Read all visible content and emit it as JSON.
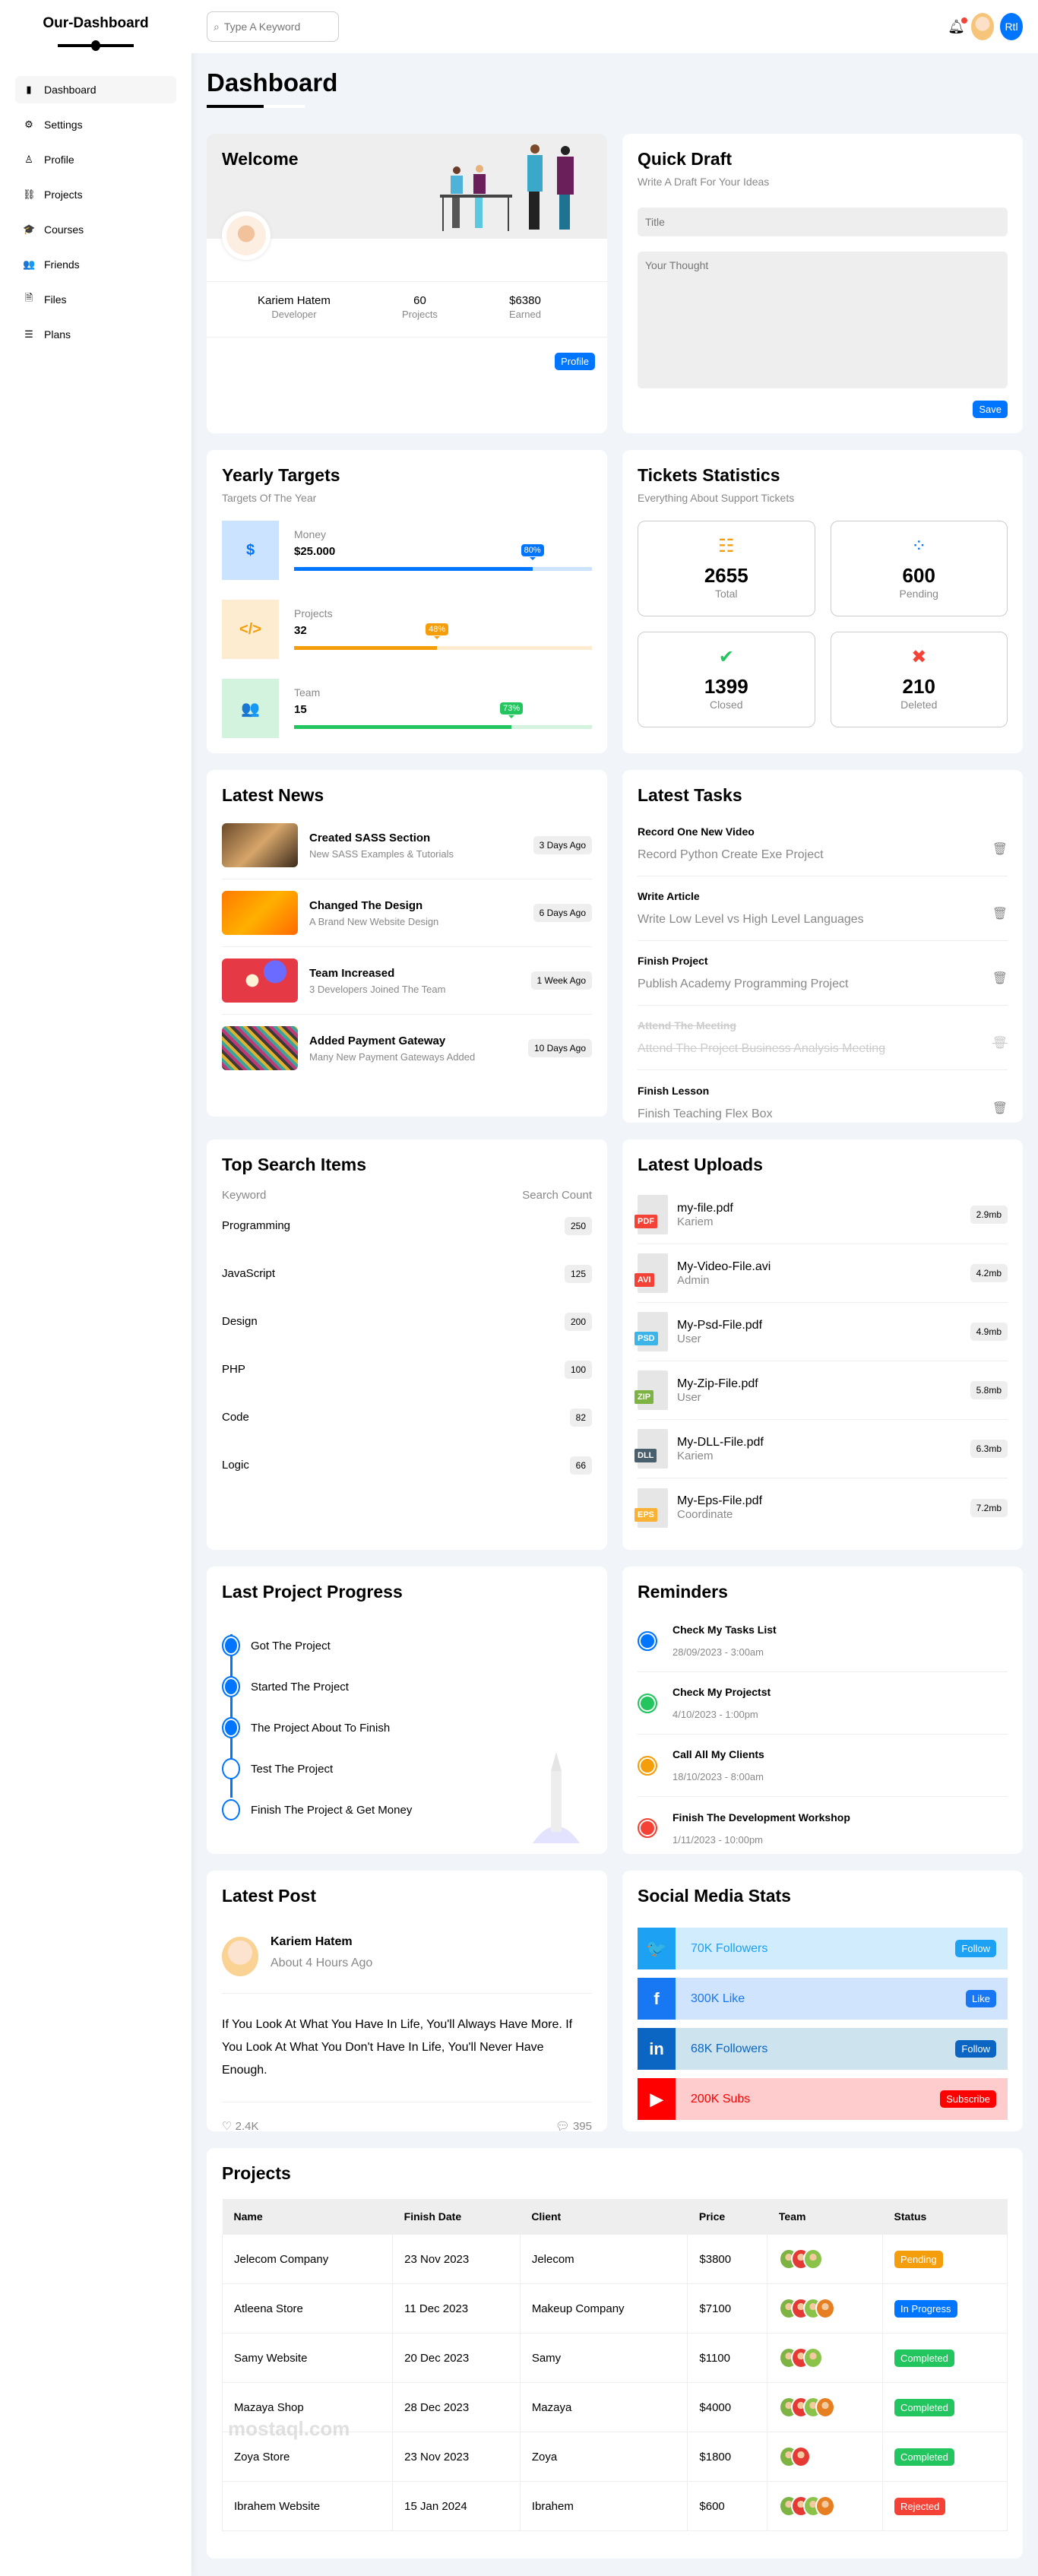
{
  "sidebar": {
    "logo": "Our-Dashboard",
    "items": [
      {
        "label": "Dashboard",
        "icon": "chart-bar-icon",
        "glyph": "▮"
      },
      {
        "label": "Settings",
        "icon": "gear-icon",
        "glyph": "⚙"
      },
      {
        "label": "Profile",
        "icon": "user-icon",
        "glyph": "♙"
      },
      {
        "label": "Projects",
        "icon": "diagram-icon",
        "glyph": "⛓"
      },
      {
        "label": "Courses",
        "icon": "graduation-cap-icon",
        "glyph": "🎓"
      },
      {
        "label": "Friends",
        "icon": "users-icon",
        "glyph": "👥"
      },
      {
        "label": "Files",
        "icon": "file-icon",
        "glyph": "🗎"
      },
      {
        "label": "Plans",
        "icon": "list-icon",
        "glyph": "☰"
      }
    ]
  },
  "header": {
    "search_placeholder": "Type A Keyword",
    "rtl_label": "Rtl"
  },
  "page_title": "Dashboard",
  "welcome": {
    "title": "Welcome",
    "name": "Kariem Hatem",
    "role": "Developer",
    "projects_value": "60",
    "projects_label": "Projects",
    "earned_value": "$6380",
    "earned_label": "Earned",
    "button": "Profile"
  },
  "draft": {
    "title": "Quick Draft",
    "subtitle": "Write A Draft For Your Ideas",
    "title_placeholder": "Title",
    "body_placeholder": "Your Thought",
    "button": "Save"
  },
  "targets": {
    "title": "Yearly Targets",
    "subtitle": "Targets Of The Year",
    "items": [
      {
        "label": "Money",
        "value": "$25.000",
        "percent": 80,
        "percent_label": "80%",
        "icon": "dollar-icon",
        "glyph": "$",
        "color": "#0075ff",
        "bg": "#cce3ff"
      },
      {
        "label": "Projects",
        "value": "32",
        "percent": 48,
        "percent_label": "48%",
        "icon": "code-icon",
        "glyph": "</>",
        "color": "#f59e0b",
        "bg": "#fdecd0"
      },
      {
        "label": "Team",
        "value": "15",
        "percent": 73,
        "percent_label": "73%",
        "icon": "users-icon",
        "glyph": "👥",
        "color": "#22c55e",
        "bg": "#d3f3df"
      }
    ]
  },
  "tickets": {
    "title": "Tickets Statistics",
    "subtitle": "Everything About Support Tickets",
    "items": [
      {
        "value": "2655",
        "label": "Total",
        "icon": "list-icon",
        "glyph": "☷",
        "color": "#f59e0b"
      },
      {
        "value": "600",
        "label": "Pending",
        "icon": "spinner-icon",
        "glyph": "⁘",
        "color": "#0075ff"
      },
      {
        "value": "1399",
        "label": "Closed",
        "icon": "check-circle-icon",
        "glyph": "✔",
        "color": "#22c55e"
      },
      {
        "value": "210",
        "label": "Deleted",
        "icon": "close-square-icon",
        "glyph": "✖",
        "color": "#f44336"
      }
    ]
  },
  "news": {
    "title": "Latest News",
    "items": [
      {
        "title": "Created SASS Section",
        "desc": "New SASS Examples & Tutorials",
        "time": "3 Days Ago",
        "bg": "linear-gradient(135deg,#6b4a2a,#d6a56a,#3a2a1a)"
      },
      {
        "title": "Changed The Design",
        "desc": "A Brand New Website Design",
        "time": "6 Days Ago",
        "bg": "linear-gradient(135deg,#ff7a00,#ffb000,#ff6a00)"
      },
      {
        "title": "Team Increased",
        "desc": "3 Developers Joined The Team",
        "time": "1 Week Ago",
        "bg": "radial-gradient(circle at 70% 30%,#6b6bff 0 18%,transparent 19%),radial-gradient(circle at 40% 50%,#fff3d6 0 12%,transparent 13%),#e63946"
      },
      {
        "title": "Added Payment Gateway",
        "desc": "Many New Payment Gateways Added",
        "time": "10 Days Ago",
        "bg": "repeating-linear-gradient(45deg,#3b3b3b 0 4px,#c03a7a 4px 8px,#3aa39a 8px 12px,#e0b030 12px 16px)"
      }
    ]
  },
  "tasks": {
    "title": "Latest Tasks",
    "items": [
      {
        "title": "Record One New Video",
        "desc": "Record Python Create Exe Project",
        "done": false
      },
      {
        "title": "Write Article",
        "desc": "Write Low Level vs High Level Languages",
        "done": false
      },
      {
        "title": "Finish Project",
        "desc": "Publish Academy Programming Project",
        "done": false
      },
      {
        "title": "Attend The Meeting",
        "desc": "Attend The Project Business Analysis Meeting",
        "done": true
      },
      {
        "title": "Finish Lesson",
        "desc": "Finish Teaching Flex Box",
        "done": false
      }
    ]
  },
  "search": {
    "title": "Top Search Items",
    "col_keyword": "Keyword",
    "col_count": "Search Count",
    "items": [
      {
        "keyword": "Programming",
        "count": "250"
      },
      {
        "keyword": "JavaScript",
        "count": "125"
      },
      {
        "keyword": "Design",
        "count": "200"
      },
      {
        "keyword": "PHP",
        "count": "100"
      },
      {
        "keyword": "Code",
        "count": "82"
      },
      {
        "keyword": "Logic",
        "count": "66"
      }
    ]
  },
  "uploads": {
    "title": "Latest Uploads",
    "items": [
      {
        "name": "my-file.pdf",
        "user": "Kariem",
        "size": "2.9mb",
        "type": "PDF",
        "color": "#f44336"
      },
      {
        "name": "My-Video-File.avi",
        "user": "Admin",
        "size": "4.2mb",
        "type": "AVI",
        "color": "#f44336"
      },
      {
        "name": "My-Psd-File.pdf",
        "user": "User",
        "size": "4.9mb",
        "type": "PSD",
        "color": "#3bb5e8"
      },
      {
        "name": "My-Zip-File.pdf",
        "user": "User",
        "size": "5.8mb",
        "type": "ZIP",
        "color": "#7cb342"
      },
      {
        "name": "My-DLL-File.pdf",
        "user": "Kariem",
        "size": "6.3mb",
        "type": "DLL",
        "color": "#4a5f6d"
      },
      {
        "name": "My-Eps-File.pdf",
        "user": "Coordinate",
        "size": "7.2mb",
        "type": "EPS",
        "color": "#f9b233"
      }
    ]
  },
  "progress": {
    "title": "Last Project Progress",
    "steps": [
      {
        "label": "Got The Project",
        "done": true
      },
      {
        "label": "Started The Project",
        "done": true
      },
      {
        "label": "The Project About To Finish",
        "done": true
      },
      {
        "label": "Test The Project",
        "done": false
      },
      {
        "label": "Finish The Project & Get Money",
        "done": false
      }
    ]
  },
  "reminders": {
    "title": "Reminders",
    "items": [
      {
        "title": "Check My Tasks List",
        "date": "28/09/2023 - 3:00am",
        "color": "#0075ff"
      },
      {
        "title": "Check My Projectst",
        "date": "4/10/2023 - 1:00pm",
        "color": "#22c55e"
      },
      {
        "title": "Call All My Clients",
        "date": "18/10/2023 - 8:00am",
        "color": "#f59e0b"
      },
      {
        "title": "Finish The Development Workshop",
        "date": "1/11/2023 - 10:00pm",
        "color": "#f44336"
      }
    ]
  },
  "post": {
    "title": "Latest Post",
    "author": "Kariem Hatem",
    "time": "About 4 Hours Ago",
    "body": "If You Look At What You Have In Life, You'll Always Have More. If You Look At What You Don't Have In Life, You'll Never Have Enough.",
    "likes": "2.4K",
    "comments": "395"
  },
  "social": {
    "title": "Social Media Stats",
    "items": [
      {
        "name": "twitter",
        "stat": "70K Followers",
        "button": "Follow",
        "glyph": "🐦",
        "color": "#1da1f2",
        "bg": "#d1ecfd"
      },
      {
        "name": "facebook",
        "stat": "300K Like",
        "button": "Like",
        "glyph": "f",
        "color": "#1877f2",
        "bg": "#d1e4fd"
      },
      {
        "name": "linkedin",
        "stat": "68K Followers",
        "button": "Follow",
        "glyph": "in",
        "color": "#0a66c2",
        "bg": "#cde3ee"
      },
      {
        "name": "youtube",
        "stat": "200K Subs",
        "button": "Subscribe",
        "glyph": "▶",
        "color": "#ff0000",
        "bg": "#fecccc"
      }
    ]
  },
  "projects": {
    "title": "Projects",
    "columns": [
      "Name",
      "Finish Date",
      "Client",
      "Price",
      "Team",
      "Status"
    ],
    "rows": [
      {
        "name": "Jelecom Company",
        "date": "23 Nov 2023",
        "client": "Jelecom",
        "price": "$3800",
        "team": 3,
        "status": "Pending",
        "color": "#f59e0b"
      },
      {
        "name": "Atleena Store",
        "date": "11 Dec 2023",
        "client": "Makeup Company",
        "price": "$7100",
        "team": 4,
        "status": "In Progress",
        "color": "#0075ff"
      },
      {
        "name": "Samy Website",
        "date": "20 Dec 2023",
        "client": "Samy",
        "price": "$1100",
        "team": 3,
        "status": "Completed",
        "color": "#22c55e"
      },
      {
        "name": "Mazaya Shop",
        "date": "28 Dec 2023",
        "client": "Mazaya",
        "price": "$4000",
        "team": 4,
        "status": "Completed",
        "color": "#22c55e"
      },
      {
        "name": "Zoya Store",
        "date": "23 Nov 2023",
        "client": "Zoya",
        "price": "$1800",
        "team": 2,
        "status": "Completed",
        "color": "#22c55e"
      },
      {
        "name": "Ibrahem Website",
        "date": "15 Jan 2024",
        "client": "Ibrahem",
        "price": "$600",
        "team": 4,
        "status": "Rejected",
        "color": "#f44336"
      }
    ]
  },
  "watermark": "mostaql.com"
}
